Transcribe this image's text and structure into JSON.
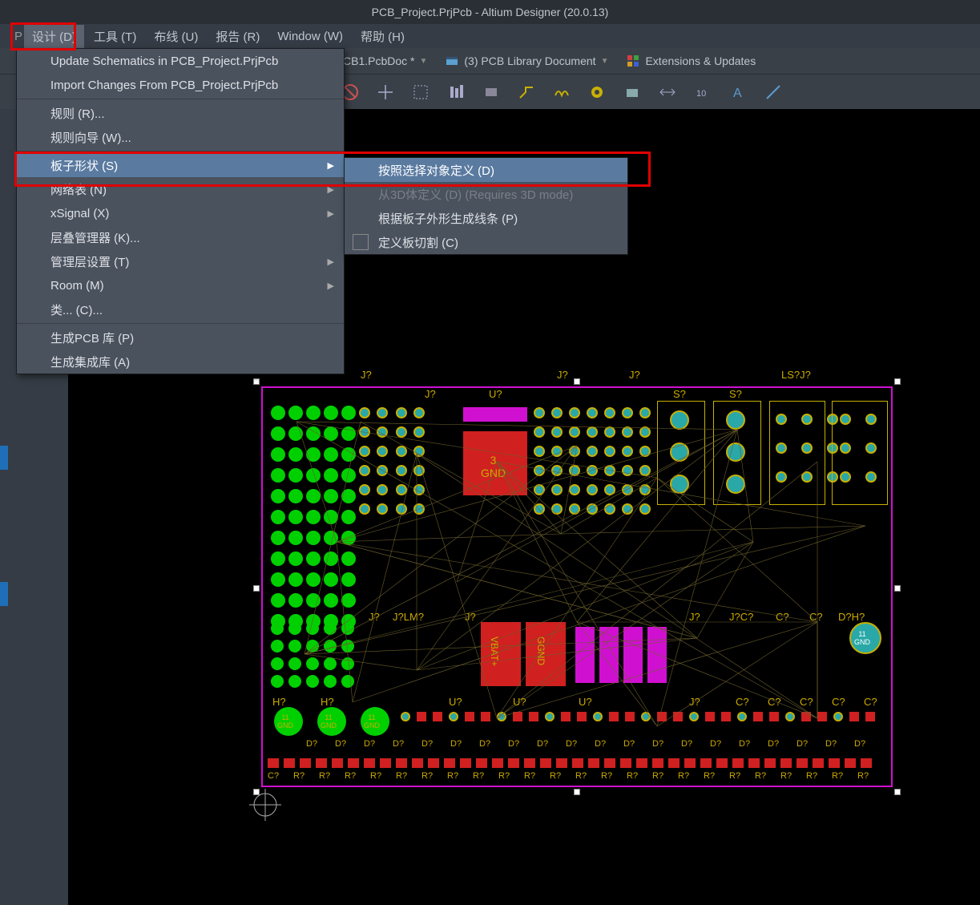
{
  "title": "PCB_Project.PrjPcb - Altium Designer (20.0.13)",
  "menubar": {
    "design": "设计 (D)",
    "tools": "工具 (T)",
    "route": "布线 (U)",
    "reports": "报告 (R)",
    "window": "Window (W)",
    "help": "帮助 (H)"
  },
  "tabs": {
    "pcbdoc": "CB1.PcbDoc *",
    "pcblib": "(3) PCB Library Document",
    "ext": "Extensions & Updates"
  },
  "dropdown": {
    "update": "Update Schematics in PCB_Project.PrjPcb",
    "import": "Import Changes From PCB_Project.PrjPcb",
    "rules": "规则 (R)...",
    "wizard": "规则向导 (W)...",
    "shape": "板子形状 (S)",
    "netlist": "网络表 (N)",
    "xsignal": "xSignal (X)",
    "stack": "层叠管理器 (K)...",
    "layer": "管理层设置 (T)",
    "room": "Room (M)",
    "classes": "类... (C)...",
    "genpcb": "生成PCB 库 (P)",
    "genint": "生成集成库 (A)"
  },
  "submenu": {
    "defsel": "按照选择对象定义 (D)",
    "def3d": "从3D体定义 (D) (Requires 3D mode)",
    "outline": "根据板子外形生成线条 (P)",
    "cutout": "定义板切割 (C)"
  },
  "designators": {
    "j1": "J?",
    "j2": "J?",
    "j3": "J?",
    "j4": "J?",
    "j5": "J?",
    "j6": "J?",
    "u1": "U?",
    "u2": "U?",
    "s1": "S?",
    "s2": "S?",
    "ls": "LS?J?",
    "lm": "J?LM?",
    "h1": "H?",
    "h2": "H?",
    "c": "C?",
    "d": "D?",
    "r": "R?",
    "vbat": "VBAT+",
    "ggnd": "GGND",
    "gnd": "GND"
  }
}
